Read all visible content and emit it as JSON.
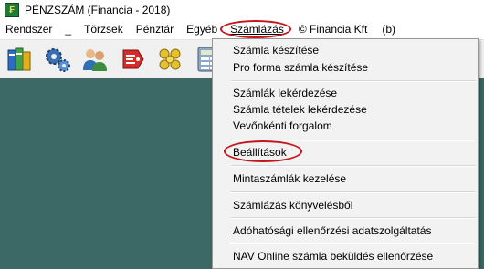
{
  "window": {
    "title": "PÉNZSZÁM (Financia - 2018)"
  },
  "menubar": {
    "items": [
      {
        "label": "Rendszer"
      },
      {
        "label": "_"
      },
      {
        "label": "Törzsek"
      },
      {
        "label": "Pénztár"
      },
      {
        "label": "Egyéb"
      },
      {
        "label": "Számlázás",
        "active": true
      },
      {
        "label": "© Financia Kft"
      },
      {
        "label": "(b)"
      }
    ]
  },
  "toolbar": {
    "buttons": [
      {
        "icon": "books-icon"
      },
      {
        "icon": "gears-icon"
      },
      {
        "icon": "users-icon"
      },
      {
        "icon": "tag-icon"
      },
      {
        "icon": "coins-icon"
      },
      {
        "icon": "calculator-icon"
      }
    ]
  },
  "dropdown": {
    "items": {
      "szamla_keszitese": "Számla készítése",
      "pro_forma": "Pro forma számla készítése",
      "szamlak_lekerdezese": "Számlák lekérdezése",
      "szamla_tetelek": "Számla tételek lekérdezése",
      "vevonkenti": "Vevőnkénti forgalom",
      "beallitasok": "Beállítások",
      "mintaszamlak": "Mintaszámlák kezelése",
      "konyvelesbol": "Számlázás könyvelésből",
      "adohatosagi": "Adóhatósági ellenőrzési adatszolgáltatás",
      "nav_online": "NAV Online számla beküldés ellenőrzése"
    }
  },
  "colors": {
    "workspace": "#3c6865",
    "highlight_oval": "#c4161c"
  }
}
